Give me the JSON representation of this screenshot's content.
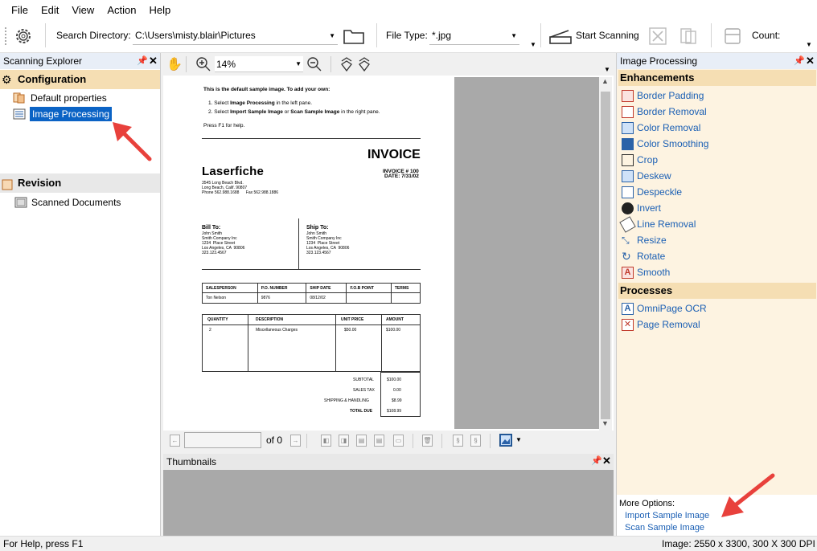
{
  "menu": [
    "File",
    "Edit",
    "View",
    "Action",
    "Help"
  ],
  "toolbar": {
    "search_dir_label": "Search Directory:",
    "search_dir_value": "C:\\Users\\misty.blair\\Pictures",
    "file_type_label": "File Type:",
    "file_type_value": "*.jpg",
    "start_scanning": "Start Scanning",
    "count_label": "Count:"
  },
  "left_panel": {
    "title": "Scanning Explorer",
    "configuration": "Configuration",
    "default_properties": "Default properties",
    "image_processing": "Image Processing",
    "revision": "Revision",
    "scanned_documents": "Scanned Documents"
  },
  "viewer": {
    "zoom": "14%",
    "page_of": "of 0"
  },
  "document": {
    "intro_title": "This is the default sample image. To add your own:",
    "intro_step1_a": "1. Select ",
    "intro_step1_b": "Image Processing",
    "intro_step1_c": " in the left pane.",
    "intro_step2_a": "2. Select ",
    "intro_step2_b": "Import Sample Image",
    "intro_step2_c": " or ",
    "intro_step2_d": "Scan Sample Image",
    "intro_step2_e": " in the right pane.",
    "intro_help": "Press F1 for help.",
    "invoice_title": "INVOICE",
    "invoice_no": "INVOICE # 100",
    "invoice_date": "DATE: 7/31/02",
    "logo": "Laserfiche",
    "company_addr": "3545 Long Beach Blvd.\nLong Beach, Calif. 90807\nPhone 562.988.1688      Fax 562.988.1886",
    "bill_to_label": "Bill To:",
    "bill_to": "John Smith\nSmith Company Inc\n1234  Place Street\nLos Angeles, CA  90806\n323.123.4567",
    "ship_to_label": "Ship To:",
    "ship_to": "John Smith\nSmith Company Inc\n1234  Place Street\nLos Angeles, CA  90806\n323.123.4567",
    "sales_headers": [
      "SALESPERSON",
      "P.O. NUMBER",
      "SHIP DATE",
      "F.O.B POINT",
      "TERMS"
    ],
    "sales_values": [
      "Ton Nelson",
      "9876",
      "08/12/02",
      "",
      ""
    ],
    "item_headers": [
      "QUANTITY",
      "DESCRIPTION",
      "UNIT PRICE",
      "AMOUNT"
    ],
    "item_row": [
      "2",
      "Miscellaneous Charges",
      "$50.00",
      "$100.00"
    ],
    "totals_labels": [
      "SUBTOTAL",
      "SALES TAX",
      "SHIPPING & HANDLING",
      "TOTAL DUE"
    ],
    "totals_values": [
      "$100.00",
      "0.00",
      "$8.99",
      "$108.99"
    ]
  },
  "thumbnails": {
    "title": "Thumbnails"
  },
  "right_panel": {
    "title": "Image Processing",
    "enhancements_label": "Enhancements",
    "enhancements": [
      "Border Padding",
      "Border Removal",
      "Color Removal",
      "Color Smoothing",
      "Crop",
      "Deskew",
      "Despeckle",
      "Invert",
      "Line Removal",
      "Resize",
      "Rotate",
      "Smooth"
    ],
    "processes_label": "Processes",
    "processes": [
      "OmniPage OCR",
      "Page Removal"
    ],
    "more_options": "More Options:",
    "import_sample": "Import Sample Image",
    "scan_sample": "Scan Sample Image"
  },
  "status": {
    "help": "For Help, press F1",
    "image_info": "Image: 2550 x 3300, 300 X 300 DPI"
  },
  "colors": {
    "accent_red": "#e8413c",
    "link_blue": "#1a5fb4",
    "selection": "#0b63c5",
    "group_bg": "#f5deb3"
  }
}
